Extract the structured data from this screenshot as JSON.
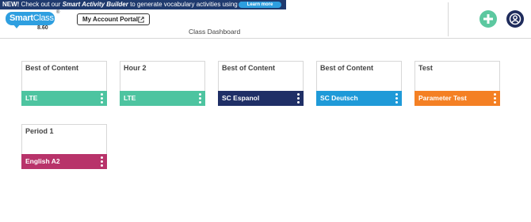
{
  "banner": {
    "new": "NEW!",
    "text_before": " Check out our ",
    "emphasis": "Smart Activity Builder",
    "text_after": " to generate vocabulary activities using AI!",
    "learn_more": "Learn more"
  },
  "header": {
    "logo_smart": "Smart",
    "logo_class": "Class",
    "logo_reg": "®",
    "version": "8.60",
    "portal_label": "My Account Portal",
    "page_title": "Class Dashboard"
  },
  "colors": {
    "lte": "#4dc4a0",
    "sc_espanol": "#1f2f66",
    "sc_deutsch": "#1f9ad8",
    "parameter_test": "#f48024",
    "english_a2": "#b8336a",
    "add_button": "#5cc8a0",
    "account_button": "#1f2c5c"
  },
  "classes": [
    {
      "title": "Best of Content",
      "label": "LTE",
      "color": "#4dc4a0"
    },
    {
      "title": "Hour 2",
      "label": "LTE",
      "color": "#4dc4a0"
    },
    {
      "title": "Best of Content",
      "label": "SC Espanol",
      "color": "#1f2f66"
    },
    {
      "title": "Best of Content",
      "label": "SC Deutsch",
      "color": "#1f9ad8"
    },
    {
      "title": "Test",
      "label": "Parameter Test",
      "color": "#f48024"
    },
    {
      "title": "Period 1",
      "label": "English A2",
      "color": "#b8336a"
    }
  ],
  "icons": {
    "add": "plus-icon",
    "account": "user-circle-icon",
    "external": "external-link-icon",
    "menu": "kebab-menu-icon"
  }
}
